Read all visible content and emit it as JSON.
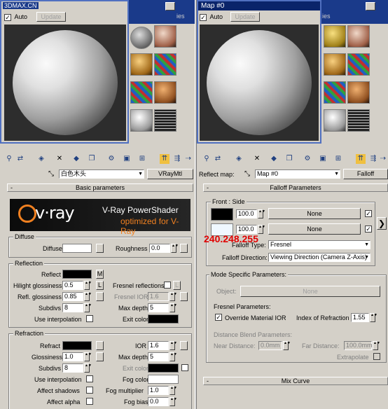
{
  "watermark": "3DMAX.CN",
  "left": {
    "preview": {
      "auto_label": "Auto",
      "update_label": "Update"
    },
    "material_name": "白色木头",
    "material_type": "VRayMtl",
    "basic_params_title": "Basic parameters",
    "vray_logo": "v·ray",
    "vray_tagline1": "V-Ray PowerShader",
    "vray_tagline2": "optimized for V-Ray",
    "diffuse": {
      "group": "Diffuse",
      "diffuse_label": "Diffuse",
      "roughness_label": "Roughness",
      "roughness": "0.0"
    },
    "reflection": {
      "group": "Reflection",
      "reflect_label": "Reflect",
      "m_label": "M",
      "hilight_label": "Hilight glossiness",
      "hilight": "0.5",
      "l_label": "L",
      "fresnel_label": "Fresnel reflections",
      "refl_gloss_label": "Refl. glossiness",
      "refl_gloss": "0.85",
      "fresnel_ior_label": "Fresnel IOR",
      "fresnel_ior": "1.6",
      "subdivs_label": "Subdivs",
      "subdivs": "8",
      "max_depth_label": "Max depth",
      "max_depth": "5",
      "use_interp_label": "Use interpolation",
      "exit_color_label": "Exit color"
    },
    "refraction": {
      "group": "Refraction",
      "refract_label": "Refract",
      "ior_label": "IOR",
      "ior": "1.6",
      "glossiness_label": "Glossiness",
      "glossiness": "1.0",
      "max_depth_label": "Max depth",
      "max_depth": "5",
      "subdivs_label": "Subdivs",
      "subdivs": "8",
      "exit_color_label": "Exit color",
      "use_interp_label": "Use interpolation",
      "fog_color_label": "Fog color",
      "affect_shadows_label": "Affect shadows",
      "fog_mult_label": "Fog multiplier",
      "fog_mult": "1.0",
      "affect_alpha_label": "Affect alpha",
      "fog_bias_label": "Fog bias",
      "fog_bias": "0.0"
    },
    "materials_tab": "ies"
  },
  "right": {
    "title": "Map #0",
    "preview": {
      "auto_label": "Auto",
      "update_label": "Update"
    },
    "reflect_map_label": "Reflect map:",
    "map_name": "Map #0",
    "map_type": "Falloff",
    "falloff_params_title": "Falloff Parameters",
    "front_side_label": "Front : Side",
    "front_value": "100.0",
    "side_value": "100.0",
    "none_label": "None",
    "rgb_overlay": "240.248.255",
    "falloff_type_label": "Falloff Type:",
    "falloff_type": "Fresnel",
    "falloff_dir_label": "Falloff Direction:",
    "falloff_dir": "Viewing Direction (Camera Z-Axis)",
    "mode_group": "Mode Specific Parameters:",
    "object_label": "Object:",
    "object_value": "None",
    "fresnel_params_label": "Fresnel Parameters:",
    "override_ior_label": "Override Material IOR",
    "ior_label": "Index of Refraction",
    "ior": "1.55",
    "distance_blend_label": "Distance Blend Parameters:",
    "near_label": "Near Distance:",
    "near": "0.0mm",
    "far_label": "Far Distance:",
    "far": "100.0mm",
    "extrapolate_label": "Extrapolate",
    "mix_curve_title": "Mix Curve",
    "materials_tab": "ies"
  },
  "colors": {
    "title_bar": "#0a246a",
    "overlay_red": "#e00000",
    "vray_orange": "#f08020"
  }
}
